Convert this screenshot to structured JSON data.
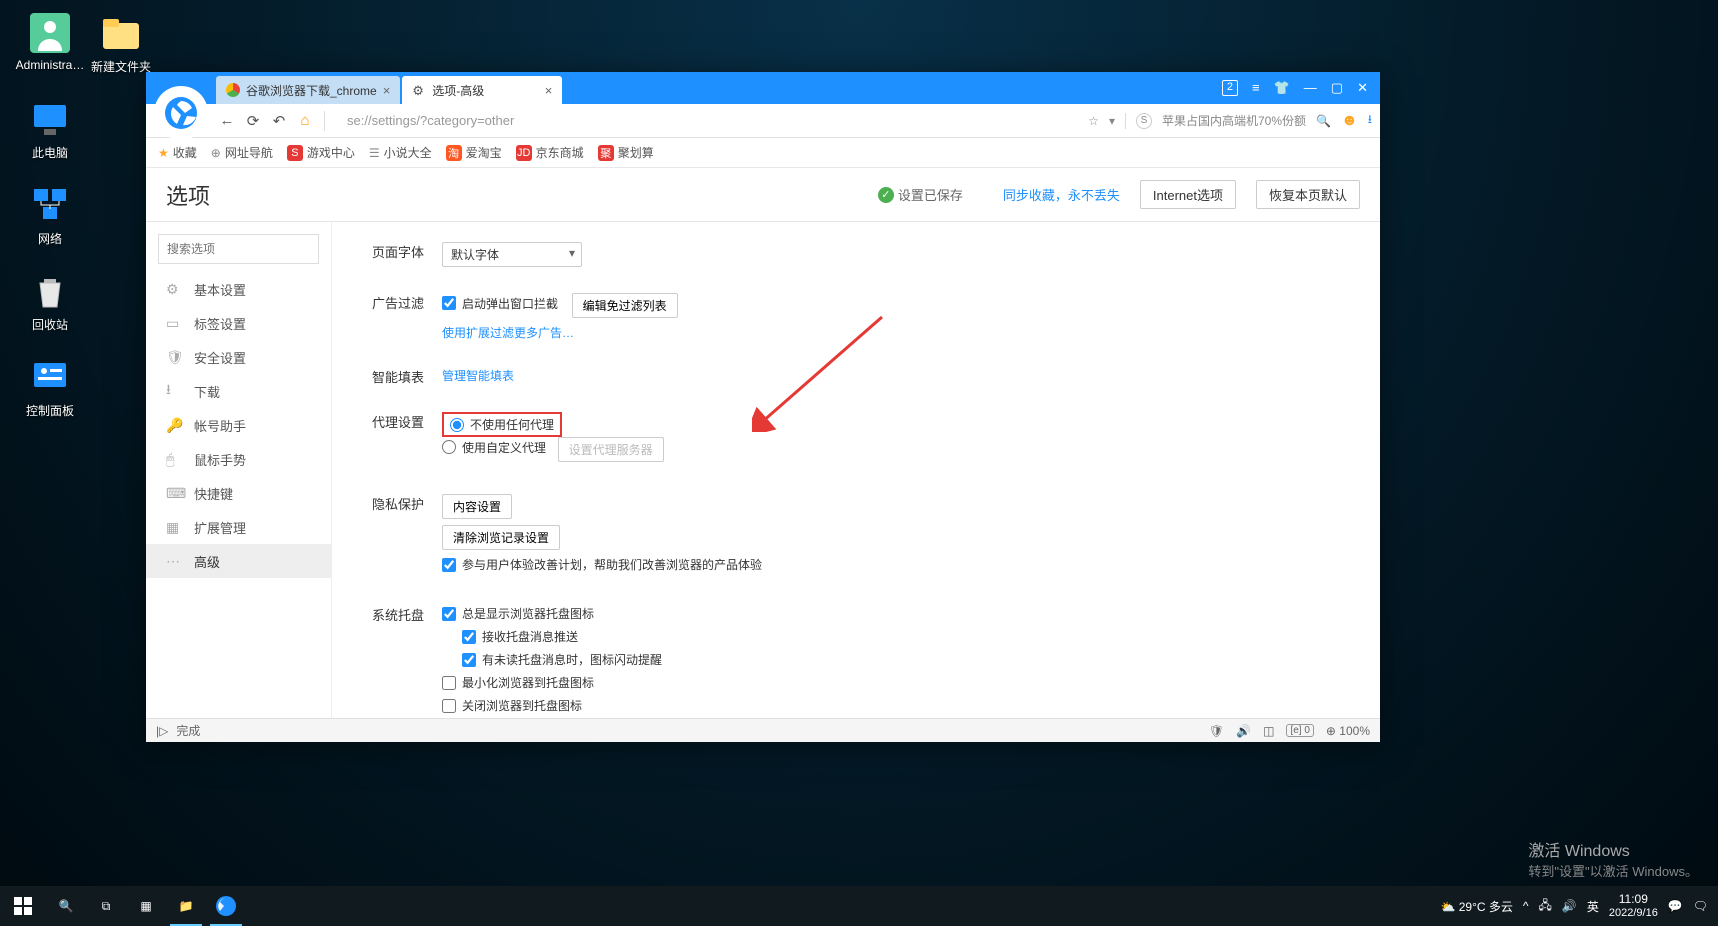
{
  "desktop": {
    "icons": [
      {
        "label": "Administra…"
      },
      {
        "label": "新建文件夹"
      },
      {
        "label": "此电脑"
      },
      {
        "label": "网络"
      },
      {
        "label": "回收站"
      },
      {
        "label": "控制面板"
      }
    ]
  },
  "browser": {
    "tabs": [
      {
        "label": "谷歌浏览器下载_chrome"
      },
      {
        "label": "选项-高级"
      }
    ],
    "url": "se://settings/?category=other",
    "hint_text": "苹果占国内高端机70%份额",
    "window_controls": {
      "badge": "2"
    }
  },
  "favbar": {
    "items": [
      {
        "label": "收藏"
      },
      {
        "label": "网址导航"
      },
      {
        "label": "游戏中心"
      },
      {
        "label": "小说大全"
      },
      {
        "label": "爱淘宝",
        "badge": "淘"
      },
      {
        "label": "京东商城",
        "badge": "JD"
      },
      {
        "label": "聚划算",
        "badge": "聚"
      }
    ]
  },
  "page": {
    "title": "选项",
    "saved_msg": "设置已保存",
    "sync_link": "同步收藏，永不丢失",
    "btn_internet": "Internet选项",
    "btn_restore": "恢复本页默认",
    "search_placeholder": "搜索选项"
  },
  "sidebar": {
    "items": [
      {
        "label": "基本设置"
      },
      {
        "label": "标签设置"
      },
      {
        "label": "安全设置"
      },
      {
        "label": "下载"
      },
      {
        "label": "帐号助手"
      },
      {
        "label": "鼠标手势"
      },
      {
        "label": "快捷键"
      },
      {
        "label": "扩展管理"
      },
      {
        "label": "高级"
      }
    ]
  },
  "settings": {
    "font": {
      "label": "页面字体",
      "value": "默认字体"
    },
    "adblock": {
      "label": "广告过滤",
      "chk": "启动弹出窗口拦截",
      "btn": "编辑免过滤列表",
      "hint": "使用扩展过滤更多广告…"
    },
    "autofill": {
      "label": "智能填表",
      "link": "管理智能填表"
    },
    "proxy": {
      "label": "代理设置",
      "opt1": "不使用任何代理",
      "opt2": "使用自定义代理",
      "btn": "设置代理服务器"
    },
    "privacy": {
      "label": "隐私保护",
      "btn1": "内容设置",
      "btn2": "清除浏览记录设置",
      "chk": "参与用户体验改善计划，帮助我们改善浏览器的产品体验"
    },
    "tray": {
      "label": "系统托盘",
      "chk1": "总是显示浏览器托盘图标",
      "chk2": "接收托盘消息推送",
      "chk3": "有未读托盘消息时，图标闪动提醒",
      "chk4": "最小化浏览器到托盘图标",
      "chk5": "关闭浏览器到托盘图标"
    }
  },
  "statusbar": {
    "text": "完成",
    "zoom": "100%"
  },
  "taskbar": {
    "weather": "29°C 多云",
    "ime": "英",
    "time": "11:09",
    "date": "2022/9/16"
  },
  "watermark": {
    "title": "激活 Windows",
    "sub": "转到\"设置\"以激活 Windows。"
  }
}
